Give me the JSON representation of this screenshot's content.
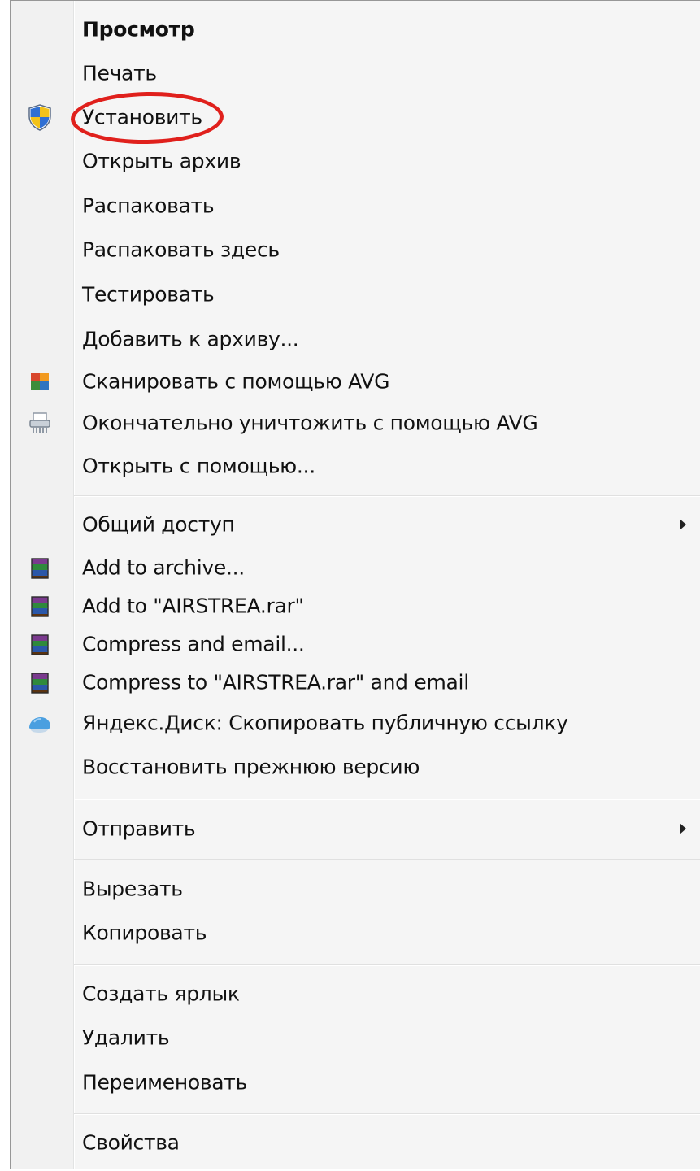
{
  "menu": {
    "items": [
      {
        "id": "view",
        "label": "Просмотр",
        "bold": true
      },
      {
        "id": "print",
        "label": "Печать"
      },
      {
        "id": "install",
        "label": "Установить",
        "icon": "uac-shield-icon"
      },
      {
        "id": "open-archive",
        "label": "Открыть архив"
      },
      {
        "id": "extract",
        "label": "Распаковать"
      },
      {
        "id": "extract-here",
        "label": "Распаковать здесь"
      },
      {
        "id": "test",
        "label": "Тестировать"
      },
      {
        "id": "add-to-archive-ru",
        "label": "Добавить к архиву..."
      },
      {
        "id": "scan-avg",
        "label": "Сканировать с помощью AVG",
        "icon": "avg-logo-icon"
      },
      {
        "id": "shred-avg",
        "label": "Окончательно уничтожить с помощью AVG",
        "icon": "shredder-icon"
      },
      {
        "id": "open-with",
        "label": "Открыть с помощью..."
      },
      {
        "id": "share",
        "label": "Общий доступ",
        "submenu": true
      },
      {
        "id": "add-to-archive",
        "label": "Add to archive...",
        "icon": "winrar-icon"
      },
      {
        "id": "add-to-rar",
        "label": "Add to \"AIRSTREA.rar\"",
        "icon": "winrar-icon"
      },
      {
        "id": "compress-email",
        "label": "Compress and email...",
        "icon": "winrar-icon"
      },
      {
        "id": "compress-rar-email",
        "label": "Compress to \"AIRSTREA.rar\" and email",
        "icon": "winrar-icon"
      },
      {
        "id": "yandex-disk",
        "label": "Яндекс.Диск: Скопировать публичную ссылку",
        "icon": "yandex-disk-icon"
      },
      {
        "id": "restore-version",
        "label": "Восстановить прежнюю версию"
      },
      {
        "id": "send-to",
        "label": "Отправить",
        "submenu": true
      },
      {
        "id": "cut",
        "label": "Вырезать"
      },
      {
        "id": "copy",
        "label": "Копировать"
      },
      {
        "id": "create-shortcut",
        "label": "Создать ярлык"
      },
      {
        "id": "delete",
        "label": "Удалить"
      },
      {
        "id": "rename",
        "label": "Переименовать"
      },
      {
        "id": "properties",
        "label": "Свойства"
      }
    ]
  },
  "colors": {
    "menu_background": "#f5f5f5",
    "highlight_ring": "#e0201c",
    "text": "#111111"
  }
}
